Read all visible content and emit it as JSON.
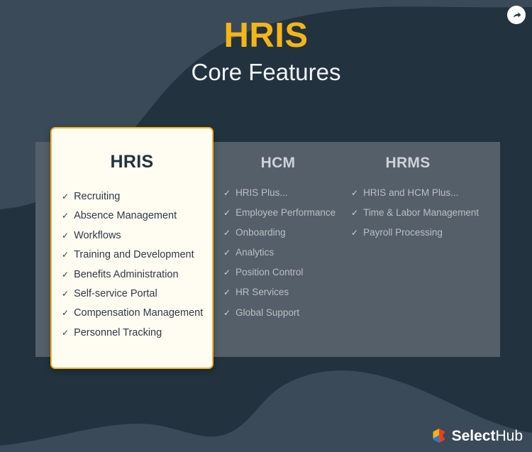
{
  "header": {
    "title": "HRIS",
    "subtitle": "Core Features"
  },
  "share_button": {
    "icon": "share-arrow-icon",
    "label": "Share"
  },
  "comparison": {
    "columns": [
      {
        "id": "hris",
        "heading": "HRIS",
        "highlighted": true,
        "features": [
          "Recruiting",
          "Absence Management",
          "Workflows",
          "Training and Development",
          "Benefits Administration",
          "Self-service Portal",
          "Compensation Management",
          "Personnel Tracking"
        ]
      },
      {
        "id": "hcm",
        "heading": "HCM",
        "highlighted": false,
        "features": [
          "HRIS Plus...",
          "Employee Performance",
          "Onboarding",
          "Analytics",
          "Position Control",
          "HR Services",
          "Global Support"
        ]
      },
      {
        "id": "hrms",
        "heading": "HRMS",
        "highlighted": false,
        "features": [
          "HRIS and HCM Plus...",
          "Time & Labor Management",
          "Payroll Processing"
        ]
      }
    ],
    "bullet_glyph": "✓"
  },
  "brand": {
    "name_bold": "Select",
    "name_light": "Hub",
    "mark": "selecthub-cube-icon"
  },
  "colors": {
    "background": "#22323f",
    "panel": "#555f69",
    "card_background": "#fffcf2",
    "card_border": "#f0b323",
    "accent_gold": "#f5b519",
    "heading_white": "#f2f4f6",
    "panel_text": "#b9bfc5",
    "card_text": "#2c3a47",
    "blob": "#3b4a58"
  }
}
